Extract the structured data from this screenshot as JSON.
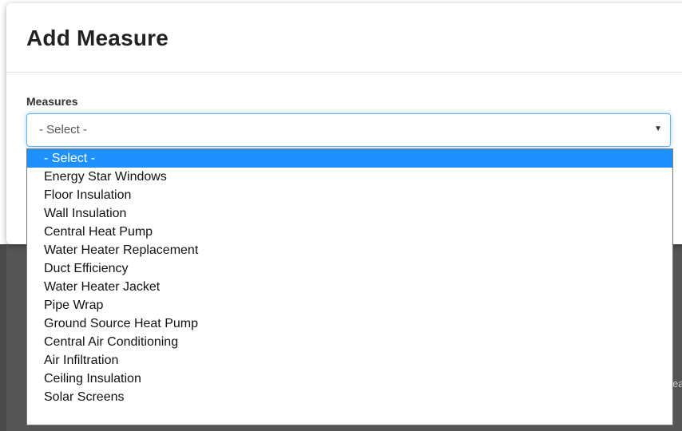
{
  "modal": {
    "title": "Add Measure"
  },
  "measures_field": {
    "label": "Measures",
    "selected_value": "- Select -"
  },
  "dropdown": {
    "options": [
      {
        "label": "- Select -",
        "selected": true
      },
      {
        "label": "Energy Star Windows"
      },
      {
        "label": "Floor Insulation"
      },
      {
        "label": "Wall Insulation"
      },
      {
        "label": "Central Heat Pump"
      },
      {
        "label": "Water Heater Replacement"
      },
      {
        "label": "Duct Efficiency"
      },
      {
        "label": "Water Heater Jacket"
      },
      {
        "label": "Pipe Wrap"
      },
      {
        "label": "Ground Source Heat Pump"
      },
      {
        "label": "Central Air Conditioning"
      },
      {
        "label": "Air Infiltration"
      },
      {
        "label": "Ceiling Insulation"
      },
      {
        "label": "Solar Screens"
      }
    ]
  },
  "background": {
    "partial_text": "ea"
  },
  "colors": {
    "selected_highlight": "#1e90ff",
    "focus_border": "#66afe9",
    "backdrop": "#555555"
  },
  "icons": {
    "select_caret": "caret-down-icon"
  }
}
